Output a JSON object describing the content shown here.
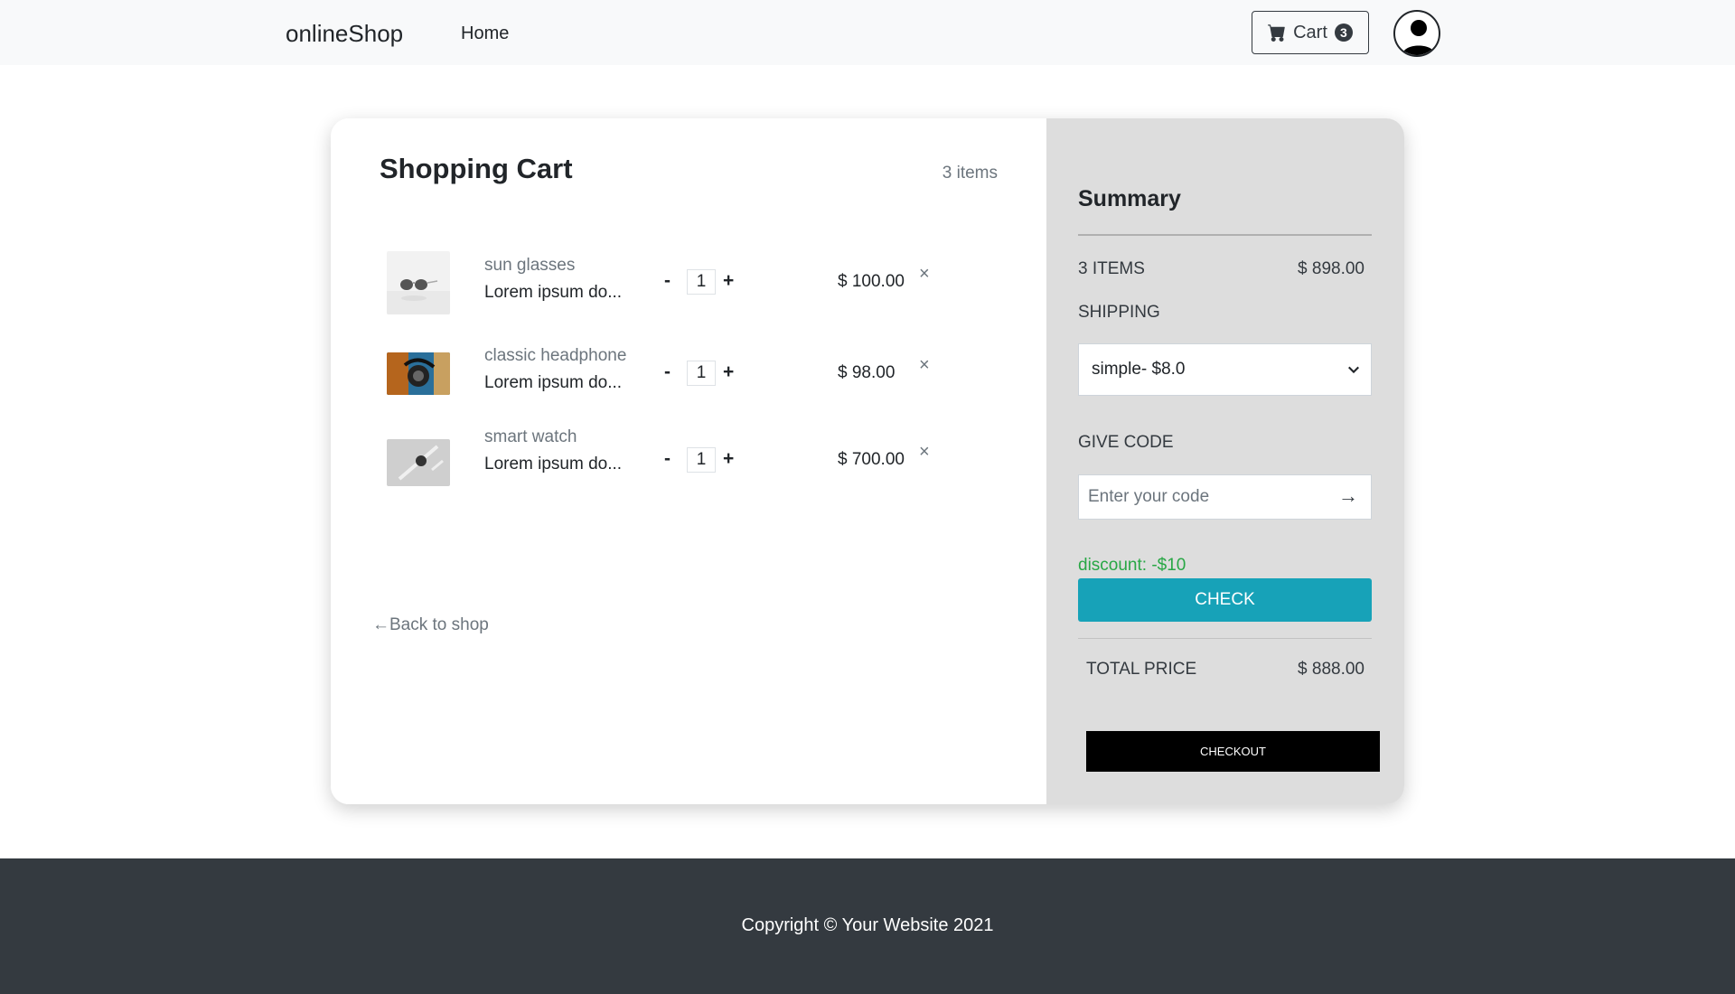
{
  "navbar": {
    "brand": "onlineShop",
    "home_link": "Home",
    "cart_label": "Cart",
    "cart_count": "3",
    "cart_icon": "cart-icon",
    "avatar_icon": "user-avatar-icon"
  },
  "cart": {
    "title": "Shopping Cart",
    "item_count": "3 items",
    "items": [
      {
        "category": "sun glasses",
        "name": "Lorem ipsum do...",
        "qty_minus": "-",
        "qty": "1",
        "qty_plus": "+",
        "price": "$ 100.00",
        "remove": "×",
        "image_icon": "sunglasses-image"
      },
      {
        "category": "classic headphone",
        "name": "Lorem ipsum do...",
        "qty_minus": "-",
        "qty": "1",
        "qty_plus": "+",
        "price": "$ 98.00",
        "remove": "×",
        "image_icon": "headphone-image"
      },
      {
        "category": "smart watch",
        "name": "Lorem ipsum do...",
        "qty_minus": "-",
        "qty": "1",
        "qty_plus": "+",
        "price": "$ 700.00",
        "remove": "×",
        "image_icon": "watch-image"
      }
    ],
    "back_link": "←Back to shop"
  },
  "summary": {
    "title": "Summary",
    "items_label": "3 ITEMS",
    "items_value": "$ 898.00",
    "shipping_label": "SHIPPING",
    "shipping_selected": "simple- $8.0",
    "code_label": "GIVE CODE",
    "code_placeholder": "Enter your code",
    "code_arrow": "→",
    "discount": "discount: -$10",
    "check_label": "CHECK",
    "total_label": "TOTAL PRICE",
    "total_value": "$ 888.00",
    "checkout_label": "CHECKOUT"
  },
  "footer": {
    "copyright": "Copyright © Your Website 2021"
  },
  "colors": {
    "accent": "#17a2b8",
    "discount": "#28a745",
    "footer_bg": "#343a40",
    "summary_bg": "#dddddd"
  }
}
